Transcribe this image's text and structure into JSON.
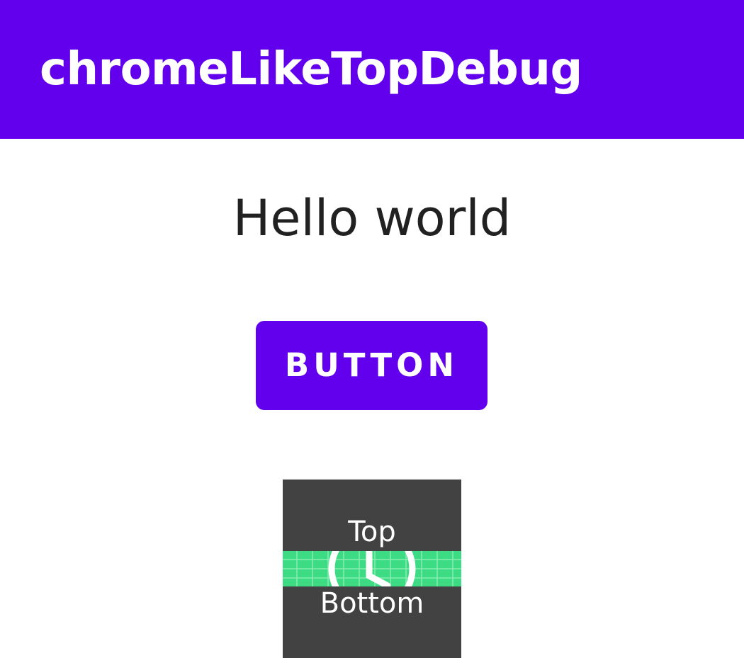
{
  "app_bar": {
    "title": "chromeLikeTopDebug",
    "color": "#6200EE"
  },
  "main": {
    "greeting": "Hello world",
    "button_label": "BUTTON"
  },
  "preview": {
    "icon": "clock-icon",
    "top_label": "Top",
    "bottom_label": "Bottom",
    "band_color": "#3DDC84",
    "background_color": "#424242"
  }
}
